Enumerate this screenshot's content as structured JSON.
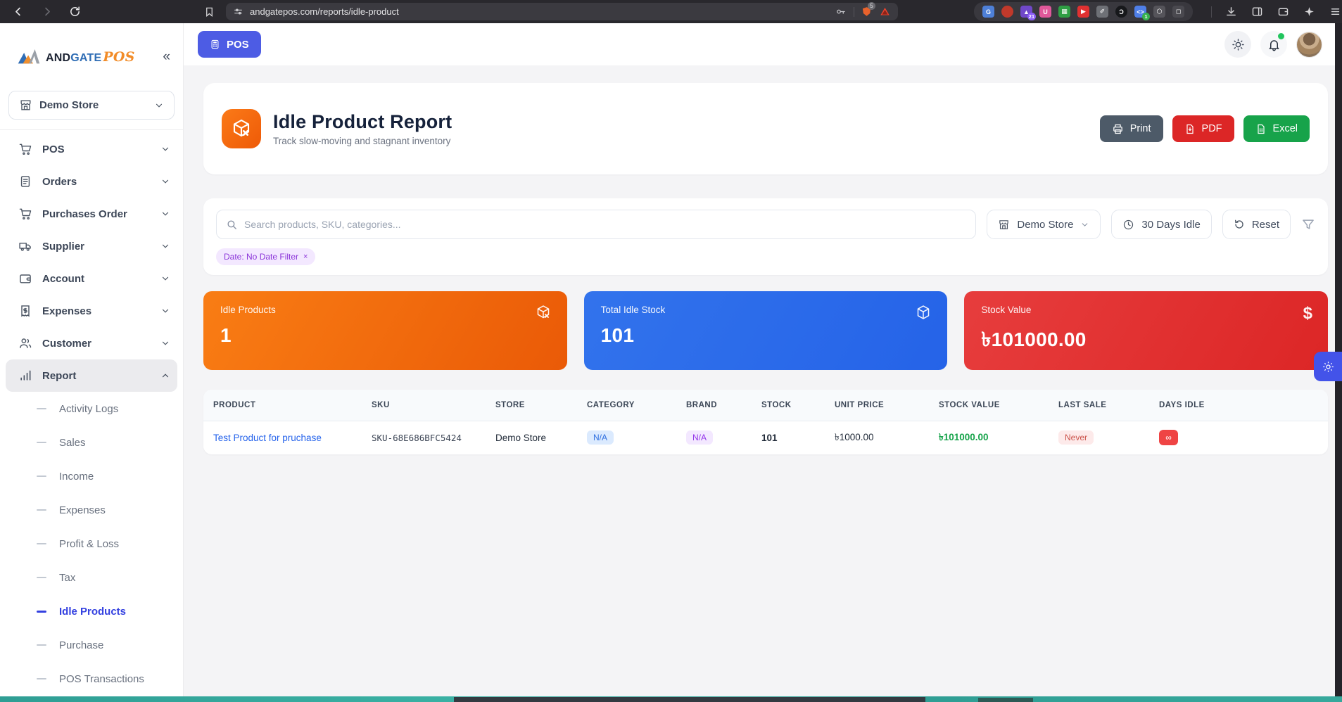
{
  "browser": {
    "url": "andgatepos.com/reports/idle-product",
    "shield_badge": "5",
    "extensions": [
      {
        "name": "translate-extension-icon",
        "color": "#4e80d8",
        "glyph": "G"
      },
      {
        "name": "red-circle-extension-icon",
        "color": "#c0392b",
        "glyph": "",
        "round": true
      },
      {
        "name": "vpn-extension-icon",
        "color": "#7048c8",
        "glyph": "▲",
        "badge": "21",
        "badge_color": "#8b5cf6"
      },
      {
        "name": "ublock-extension-icon",
        "color": "#e0589a",
        "glyph": "U"
      },
      {
        "name": "grid-extension-icon",
        "color": "#2f9e44",
        "glyph": "▦"
      },
      {
        "name": "video-extension-icon",
        "color": "#e03131",
        "glyph": "▶"
      },
      {
        "name": "eyedropper-extension-icon",
        "color": "#6e7076",
        "glyph": "✐"
      },
      {
        "name": "dark-mode-extension-icon",
        "color": "#17181b",
        "glyph": "Ɔ",
        "round": true
      },
      {
        "name": "code-extension-icon",
        "color": "#4f7fe8",
        "glyph": "<>",
        "badge": "1",
        "badge_color": "#37b24d"
      },
      {
        "name": "puzzle-extension-icon",
        "color": "#55545a",
        "glyph": "⬡"
      },
      {
        "name": "box-extension-icon",
        "color": "#4a494f",
        "glyph": "◻"
      }
    ]
  },
  "header": {
    "pos_button": "POS"
  },
  "sidebar": {
    "logo": {
      "and": "AND",
      "gate": "GATE",
      "pos": "POS",
      "collapse": "«"
    },
    "store": "Demo Store",
    "items": [
      {
        "label": "POS"
      },
      {
        "label": "Orders"
      },
      {
        "label": "Purchases Order"
      },
      {
        "label": "Supplier"
      },
      {
        "label": "Account"
      },
      {
        "label": "Expenses"
      },
      {
        "label": "Customer"
      },
      {
        "label": "Report"
      }
    ],
    "report_children": [
      {
        "label": "Activity Logs"
      },
      {
        "label": "Sales"
      },
      {
        "label": "Income"
      },
      {
        "label": "Expenses"
      },
      {
        "label": "Profit & Loss"
      },
      {
        "label": "Tax"
      },
      {
        "label": "Idle Products",
        "active": true
      },
      {
        "label": "Purchase"
      },
      {
        "label": "POS Transactions"
      }
    ]
  },
  "page": {
    "title": "Idle Product Report",
    "subtitle": "Track slow-moving and stagnant inventory",
    "buttons": {
      "print": "Print",
      "pdf": "PDF",
      "excel": "Excel"
    }
  },
  "filters": {
    "search_placeholder": "Search products, SKU, categories...",
    "store": "Demo Store",
    "idle_period": "30 Days Idle",
    "reset": "Reset",
    "date_chip": "Date: No Date Filter",
    "date_chip_close": "×"
  },
  "stats": [
    {
      "label": "Idle Products",
      "value": "1",
      "color": "#ea580c"
    },
    {
      "label": "Total Idle Stock",
      "value": "101",
      "color": "#2563eb"
    },
    {
      "label": "Stock Value",
      "value": "৳101000.00",
      "color": "#dc2626"
    }
  ],
  "table": {
    "columns": [
      "PRODUCT",
      "SKU",
      "STORE",
      "CATEGORY",
      "BRAND",
      "STOCK",
      "UNIT PRICE",
      "STOCK VALUE",
      "LAST SALE",
      "DAYS IDLE"
    ],
    "rows": [
      {
        "product": "Test Product for pruchase",
        "sku": "SKU-68E686BFC5424",
        "store": "Demo Store",
        "category": "N/A",
        "brand": "N/A",
        "stock": "101",
        "unit_price": "৳1000.00",
        "stock_value": "৳101000.00",
        "last_sale": "Never",
        "days_idle": "∞"
      }
    ]
  },
  "colors": {
    "primary": "#4d5ce4",
    "orange": "#ea580c",
    "blue": "#2563eb",
    "red": "#dc2626",
    "green": "#17a34a"
  }
}
